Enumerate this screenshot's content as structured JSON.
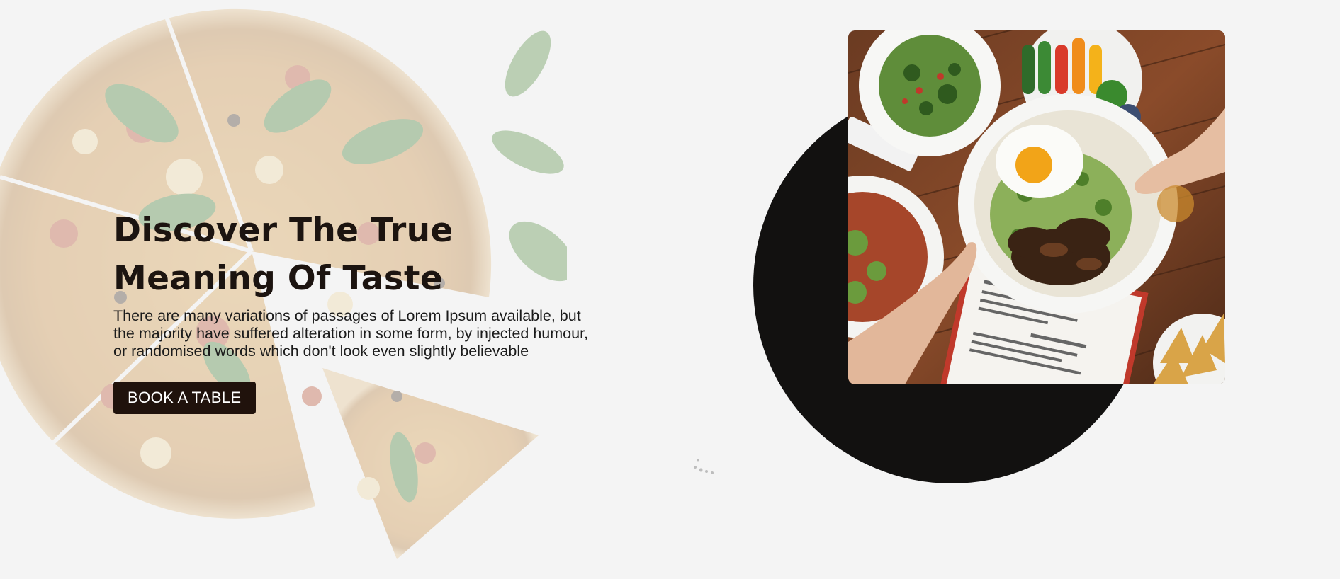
{
  "hero": {
    "title": "Discover The True Meaning Of Taste",
    "description": "There are many variations of passages of Lorem Ipsum available, but the majority have suffered alteration in some form, by injected humour, or randomised words which don't look even slightly believable",
    "cta_label": "BOOK A TABLE"
  },
  "colors": {
    "page_background": "#f4f4f4",
    "button_background": "#20120c",
    "button_text": "#ffffff",
    "circle": "#121110",
    "title_text": "#1c1410"
  },
  "icons": {
    "background_image": "pizza-illustration",
    "hero_photo": "food-table-photo",
    "decoration": "black-circle"
  }
}
